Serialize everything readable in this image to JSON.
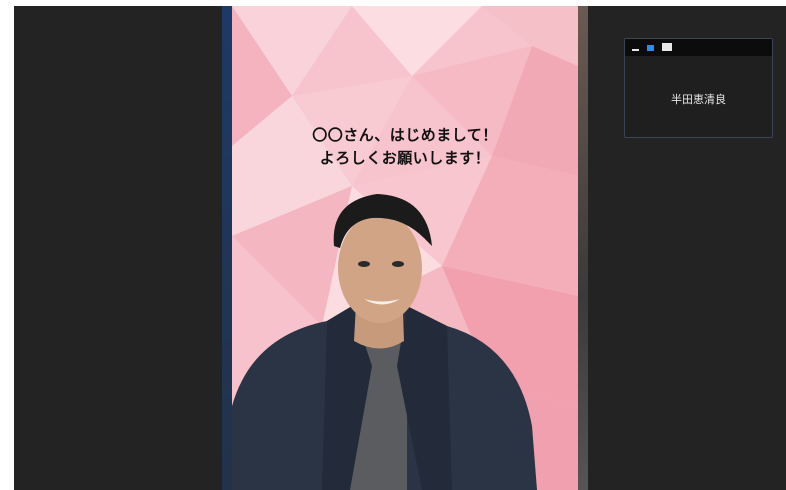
{
  "video": {
    "overlay_line1": "〇〇さん、はじめまして！",
    "overlay_line2": "よろしくお願いします！"
  },
  "self_view": {
    "name": "半田恵清良",
    "controls": [
      "minimize-icon",
      "speaker-view-icon",
      "maximize-icon"
    ]
  },
  "colors": {
    "app_background": "#232323",
    "video_background": "#f7c3cc",
    "accent": "#2e8de8"
  }
}
